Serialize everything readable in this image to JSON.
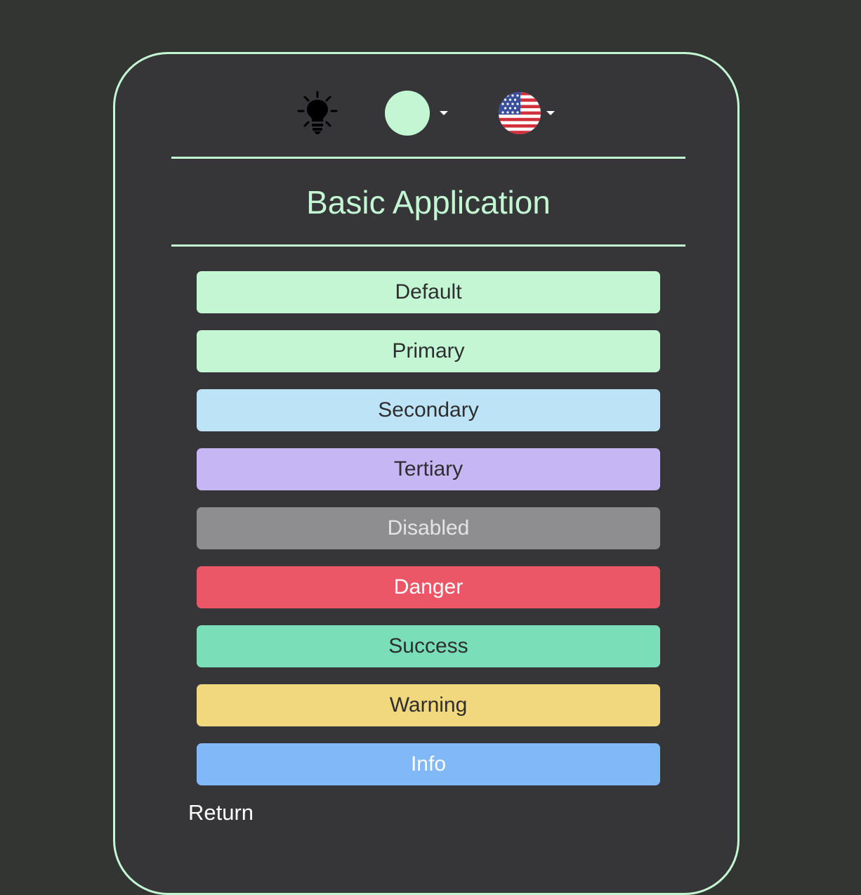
{
  "toolbar": {
    "theme_icon": "lightbulb-icon",
    "color_swatch": "#c3f7d3",
    "language_icon": "us-flag-icon"
  },
  "title": "Basic Application",
  "buttons": [
    {
      "label": "Default",
      "variant": "default",
      "color": "#c3f7d3"
    },
    {
      "label": "Primary",
      "variant": "primary",
      "color": "#c3f7d3"
    },
    {
      "label": "Secondary",
      "variant": "secondary",
      "color": "#bde3f6"
    },
    {
      "label": "Tertiary",
      "variant": "tertiary",
      "color": "#c7b6f4"
    },
    {
      "label": "Disabled",
      "variant": "disabled",
      "color": "#8e8e90"
    },
    {
      "label": "Danger",
      "variant": "danger",
      "color": "#eb5767"
    },
    {
      "label": "Success",
      "variant": "success",
      "color": "#7adfb9"
    },
    {
      "label": "Warning",
      "variant": "warning",
      "color": "#f1d87c"
    },
    {
      "label": "Info",
      "variant": "info",
      "color": "#80b8f8"
    }
  ],
  "return_label": "Return",
  "colors": {
    "background": "#333533",
    "card": "#363638",
    "accent": "#c3f7d3"
  }
}
